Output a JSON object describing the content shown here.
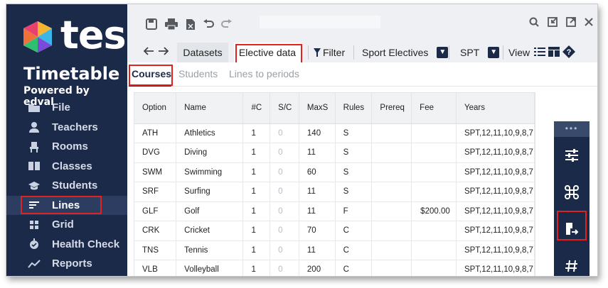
{
  "brand": {
    "name": "tes",
    "product": "Timetable",
    "powered_by": "Powered by edval"
  },
  "sidebar": {
    "items": [
      {
        "label": "File",
        "icon": "folder-icon"
      },
      {
        "label": "Teachers",
        "icon": "person-icon"
      },
      {
        "label": "Rooms",
        "icon": "chair-icon"
      },
      {
        "label": "Classes",
        "icon": "book-icon"
      },
      {
        "label": "Students",
        "icon": "graduation-cap-icon"
      },
      {
        "label": "Lines",
        "icon": "lines-icon",
        "active": true
      },
      {
        "label": "Grid",
        "icon": "grid-icon"
      },
      {
        "label": "Health Check",
        "icon": "health-check-icon"
      },
      {
        "label": "Reports",
        "icon": "chart-trend-icon"
      }
    ]
  },
  "toolbar": {
    "tabs": {
      "datasets": "Datasets",
      "elective": "Elective data"
    },
    "filter_label": "Filter",
    "sport_select": "Sport Electives",
    "spt_select": "SPT",
    "view_label": "View"
  },
  "subtabs": {
    "courses": "Courses",
    "students": "Students",
    "lines_to_periods": "Lines to periods"
  },
  "table": {
    "headers": [
      "Option",
      "Name",
      "#C",
      "S/C",
      "MaxS",
      "Rules",
      "Prereq",
      "Fee",
      "Years"
    ],
    "rows": [
      [
        "ATH",
        "Athletics",
        "1",
        "0",
        "140",
        "S",
        "",
        "",
        "SPT,12,11,10,9,8,7"
      ],
      [
        "DVG",
        "Diving",
        "1",
        "0",
        "11",
        "S",
        "",
        "",
        "SPT,12,11,10,9,8,7"
      ],
      [
        "SWM",
        "Swimming",
        "1",
        "0",
        "60",
        "S",
        "",
        "",
        "SPT,12,11,10,9,8,7"
      ],
      [
        "SRF",
        "Surfing",
        "1",
        "0",
        "11",
        "S",
        "",
        "",
        "SPT,12,11,10,9,8,7"
      ],
      [
        "GLF",
        "Golf",
        "1",
        "0",
        "11",
        "F",
        "",
        "$200.00",
        "SPT,12,11,10,9,8,7"
      ],
      [
        "CRK",
        "Cricket",
        "1",
        "0",
        "70",
        "C",
        "",
        "",
        "SPT,12,11,10,9,8,7"
      ],
      [
        "TNS",
        "Tennis",
        "1",
        "0",
        "11",
        "C",
        "",
        "",
        "SPT,12,11,10,9,8,7"
      ],
      [
        "VLB",
        "Volleyball",
        "1",
        "0",
        "200",
        "C",
        "",
        "",
        "SPT,12,11,10,9,8,7"
      ]
    ]
  },
  "colors": {
    "sidebar": "#1c2a4a",
    "highlight": "#e0231e"
  }
}
